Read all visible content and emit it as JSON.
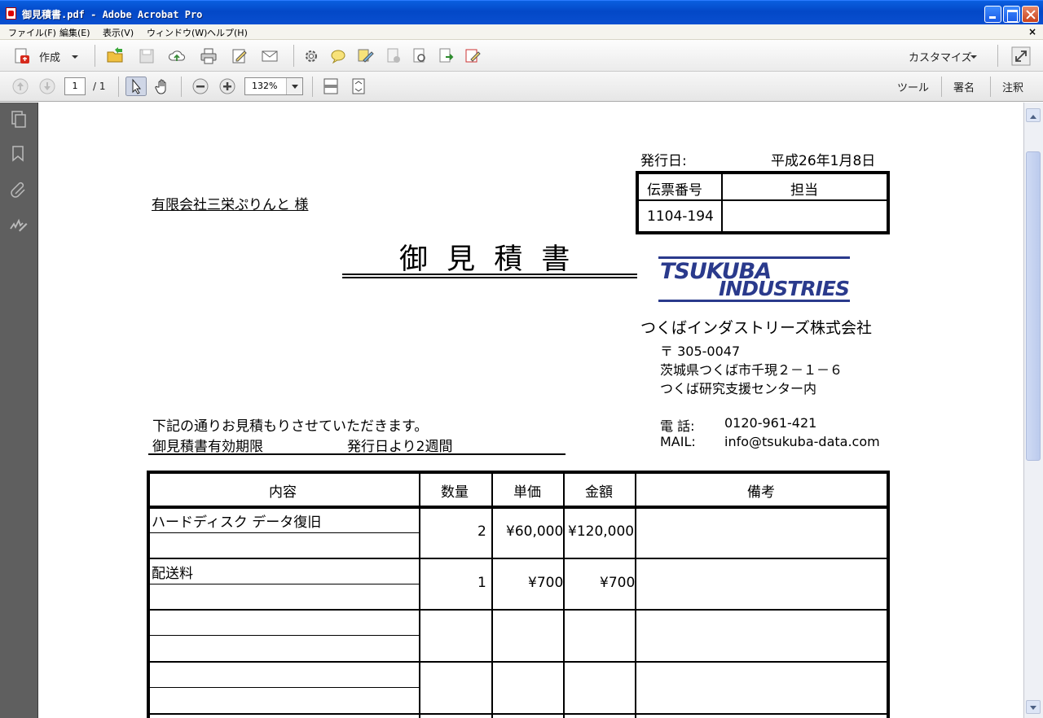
{
  "window": {
    "title": "御見積書.pdf - Adobe Acrobat Pro",
    "doc_close": "×"
  },
  "menu": [
    "ファイル(F)",
    "編集(E)",
    "表示(V)",
    "ウィンドウ(W)",
    "ヘルプ(H)"
  ],
  "toolbar": {
    "create_label": "作成",
    "customize_label": "カスタマイズ",
    "page_current": "1",
    "page_total": "/ 1",
    "zoom": "132%",
    "tools_label": "ツール",
    "sign_label": "署名",
    "comment_label": "注釈"
  },
  "icons": {
    "create": "create-pdf-icon",
    "open": "open-folder-icon",
    "save": "save-icon",
    "upload": "cloud-upload-icon",
    "print": "print-icon",
    "edit": "edit-form-icon",
    "email": "email-icon",
    "settings": "gear-icon",
    "comment": "speech-bubble-icon",
    "highlight": "highlight-icon",
    "fullscreen": "expand-icon"
  },
  "colors": {
    "titlebar": "#0348c7",
    "logo": "#2a3a8c",
    "nav_panel": "#5f5f5f"
  },
  "document": {
    "issue_label": "発行日:",
    "issue_date": "平成26年1月8日",
    "slip_label": "伝票番号",
    "staff_label": "担当",
    "slip_no": "1104-194",
    "staff_value": "",
    "recipient": "有限会社三栄ぷりんと 様",
    "title": "御 見 積 書",
    "logo_line1": "TSUKUBA",
    "logo_line2": "INDUSTRIES",
    "company": "つくばインダストリーズ株式会社",
    "postal": "〒 305-0047",
    "address1": "茨城県つくば市千現２－１－６",
    "address2": "つくば研究支援センター内",
    "tel_label": "電 話:",
    "tel": "0120-961-421",
    "mail_label": "MAIL:",
    "mail": "info@tsukuba-data.com",
    "intro": "下記の通りお見積もりさせていただきます。",
    "validity_label": "御見積書有効期限",
    "validity_value": "発行日より2週間",
    "table": {
      "headers": [
        "内容",
        "数量",
        "単価",
        "金額",
        "備考"
      ],
      "rows": [
        {
          "item": "ハードディスク データ復旧",
          "qty": "2",
          "unit": "¥60,000",
          "amount": "¥120,000",
          "note": ""
        },
        {
          "item": "配送料",
          "qty": "1",
          "unit": "¥700",
          "amount": "¥700",
          "note": ""
        },
        {
          "item": "",
          "qty": "",
          "unit": "",
          "amount": "",
          "note": ""
        },
        {
          "item": "",
          "qty": "",
          "unit": "",
          "amount": "",
          "note": ""
        }
      ]
    }
  }
}
